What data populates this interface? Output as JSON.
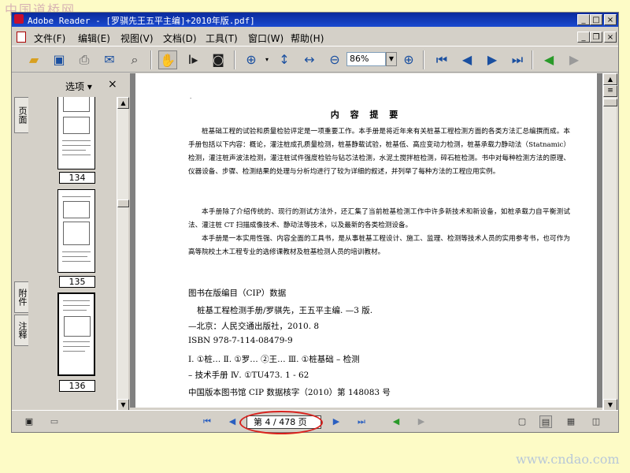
{
  "watermark_top": "中国道桥网",
  "watermark_bottom": "www.cndao.com",
  "window": {
    "title": "Adobe Reader - [罗骐先王五平主编]+2010年版.pdf]",
    "buttons": [
      "_",
      "□",
      "×"
    ],
    "doc_buttons": [
      "_",
      "❐",
      "×"
    ]
  },
  "menu": [
    "文件(F)",
    "编辑(E)",
    "视图(V)",
    "文档(D)",
    "工具(T)",
    "窗口(W)",
    "帮助(H)"
  ],
  "toolbar": {
    "icons": [
      "open-icon",
      "save-icon",
      "print-icon",
      "email-icon",
      "search-icon",
      "hand-tool-icon",
      "select-text-icon",
      "snapshot-icon",
      "zoom-in-tool-icon",
      "fit-page-icon",
      "fit-width-icon",
      "zoom-out-icon",
      "zoom-in-icon",
      "first-page-icon",
      "previous-page-icon",
      "next-page-icon",
      "last-page-icon",
      "previous-view-icon",
      "next-view-icon"
    ],
    "zoom_value": "86%"
  },
  "left_tabs": [
    "页面",
    "附件",
    "注释"
  ],
  "nav_panel": {
    "options_label": "选项 ▾",
    "close": "×",
    "thumbnails": [
      "134",
      "135",
      "136"
    ]
  },
  "document": {
    "heading": "内 容 提 要",
    "paragraphs": [
      "桩基础工程的试验和质量检验评定是一项重要工作。本手册是将近年来有关桩基工程检测方面的各类方法汇总编撰而成。本手册包括以下内容：概论，灌注桩成孔质量检测，桩基静载试验，桩基低、高应变动力检测，桩基承载力静动法（Statnamic）检测，灌注桩声波法检测，灌注桩试件强度检验与钻芯法检测，水泥土搅拌桩检测，碎石桩检测。书中对每种检测方法的原理、仪器设备、步骤、检测结果的处理与分析均进行了较为详细的叙述，并列举了每种方法的工程应用实例。",
      "本手册除了介绍传统的、现行的测试方法外，还汇集了当前桩基检测工作中许多新技术和新设备，如桩承载力自平衡测试法、灌注桩 CT 扫描成像技术、静动法等技术，以及最新的各类检测设备。",
      "本手册是一本实用性强、内容全面的工具书，是从事桩基工程设计、施工、监理、检测等技术人员的实用参考书，也可作为高等院校土木工程专业的选修课教材及桩基检测人员的培训教材。"
    ],
    "cip_title": "图书在版编目（CIP）数据",
    "cip_lines": [
      "桩基工程检测手册/罗骐先，王五平主编. —3 版.",
      "—北京：人民交通出版社，2010. 8",
      "ISBN  978-7-114-08479-9",
      "Ⅰ. ①桩…   Ⅱ. ①罗…  ②王…    Ⅲ. ①桩基础 – 检测",
      "– 技术手册    Ⅳ. ①TU473. 1 - 62",
      "中国版本图书馆 CIP 数据核字（2010）第 148083 号"
    ]
  },
  "statusbar": {
    "page_indicator": "第 4 / 478 页",
    "icons": [
      "panel-toggle-icon",
      "minimize-panel-icon",
      "first-page-icon",
      "previous-page-icon",
      "next-page-icon",
      "last-page-icon",
      "previous-view-icon",
      "next-view-icon",
      "single-page-icon",
      "continuous-icon",
      "facing-icon",
      "continuous-facing-icon"
    ]
  },
  "colors": {
    "background": "#fdfbc6",
    "title_bar": "#0a2a9c",
    "annotation_ellipse": "#d8201c"
  }
}
